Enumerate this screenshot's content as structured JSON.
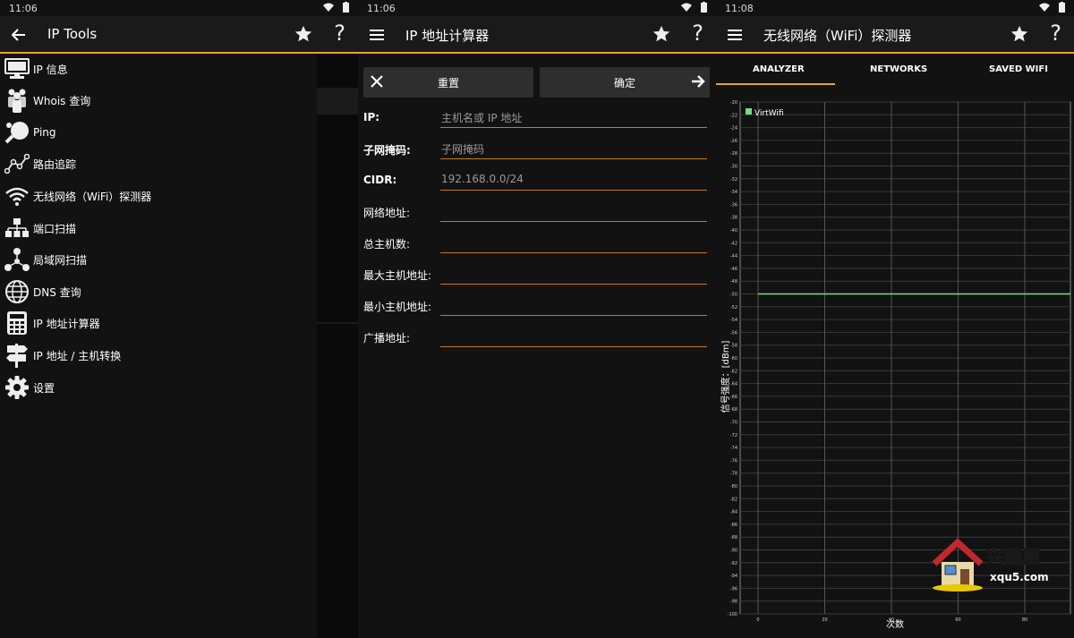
{
  "panel1": {
    "time": "11:06",
    "title": "IP Tools",
    "menu": [
      {
        "label": "IP 信息",
        "icon": "monitor-icon"
      },
      {
        "label": "Whois 查询",
        "icon": "people-icon"
      },
      {
        "label": "Ping",
        "icon": "ping-pong-icon"
      },
      {
        "label": "路由追踪",
        "icon": "route-icon"
      },
      {
        "label": "无线网络（WiFi）探测器",
        "icon": "wifi-icon"
      },
      {
        "label": "端口扫描",
        "icon": "network-tree-icon"
      },
      {
        "label": "局域网扫描",
        "icon": "lan-icon"
      },
      {
        "label": "DNS 查询",
        "icon": "globe-icon"
      },
      {
        "label": "IP 地址计算器",
        "icon": "calculator-icon"
      },
      {
        "label": "IP 地址 / 主机转换",
        "icon": "signpost-icon"
      },
      {
        "label": "设置",
        "icon": "gear-icon"
      }
    ]
  },
  "panel2": {
    "time": "11:06",
    "title": "IP 地址计算器",
    "reset_label": "重置",
    "confirm_label": "确定",
    "fields": [
      {
        "label": "IP:",
        "value": "主机名或 IP 地址",
        "bold": true
      },
      {
        "label": "子网掩码:",
        "value": "子网掩码",
        "bold": true
      },
      {
        "label": "CIDR:",
        "value": "192.168.0.0/24",
        "bold": true
      },
      {
        "label": "网络地址:",
        "value": "",
        "bold": false
      },
      {
        "label": "总主机数:",
        "value": "",
        "bold": false
      },
      {
        "label": "最大主机地址:",
        "value": "",
        "bold": false
      },
      {
        "label": "最小主机地址:",
        "value": "",
        "bold": false
      },
      {
        "label": "广播地址:",
        "value": "",
        "bold": false
      }
    ]
  },
  "panel3": {
    "time": "11:08",
    "title": "无线网络（WiFi）探测器",
    "tabs": [
      "ANALYZER",
      "NETWORKS",
      "SAVED WIFI"
    ],
    "watermark_text": "兴趣屋",
    "watermark_url": "xqu5.com"
  },
  "chart_data": {
    "type": "line",
    "ylabel": "信号强度：[dBm]",
    "xlabel": "次数",
    "ylim": [
      -100,
      -20
    ],
    "yticks": [
      -20,
      -22,
      -24,
      -26,
      -28,
      -30,
      -32,
      -34,
      -36,
      -38,
      -40,
      -42,
      -44,
      -46,
      -48,
      -50,
      -52,
      -54,
      -56,
      -58,
      -60,
      -62,
      -64,
      -66,
      -68,
      -70,
      -72,
      -74,
      -76,
      -78,
      -80,
      -82,
      -84,
      -86,
      -88,
      -90,
      -92,
      -94,
      -96,
      -98,
      -100
    ],
    "xticks": [
      0,
      20,
      40,
      60,
      80
    ],
    "xlim": [
      0,
      100
    ],
    "series": [
      {
        "name": "VirtWifi",
        "color": "#6fe08a",
        "x": [
          0,
          100
        ],
        "y": [
          -50,
          -50
        ]
      }
    ],
    "legend": "top-left",
    "grid": true
  },
  "colors": {
    "accent": "#e8a33a",
    "field_line": "#c77a1a",
    "series": "#6fe08a"
  }
}
